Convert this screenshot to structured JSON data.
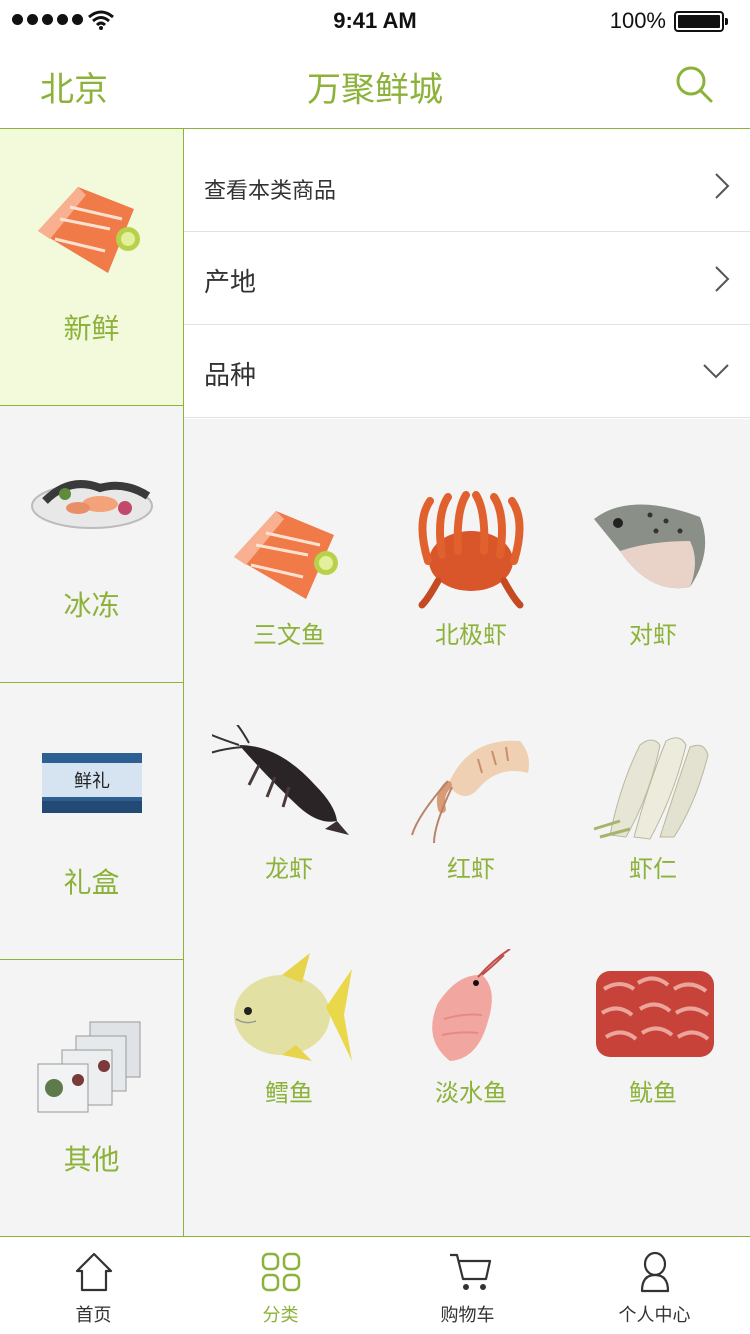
{
  "status_bar": {
    "time": "9:41 AM",
    "battery": "100%"
  },
  "nav": {
    "city": "北京",
    "title": "万聚鲜城"
  },
  "sidebar": {
    "items": [
      {
        "label": "新鲜",
        "active": true
      },
      {
        "label": "冰冻",
        "active": false
      },
      {
        "label": "礼盒",
        "active": false
      },
      {
        "label": "其他",
        "active": false
      }
    ]
  },
  "filters": [
    {
      "label": "查看本类商品",
      "icon": "chevron-right-icon"
    },
    {
      "label": "产地",
      "icon": "chevron-right-icon"
    },
    {
      "label": "品种",
      "icon": "chevron-down-icon"
    }
  ],
  "products": [
    {
      "name": "三文鱼"
    },
    {
      "name": "北极虾"
    },
    {
      "name": "对虾"
    },
    {
      "name": "龙虾"
    },
    {
      "name": "红虾"
    },
    {
      "name": "虾仁"
    },
    {
      "name": "鳕鱼"
    },
    {
      "name": "淡水鱼"
    },
    {
      "name": "鱿鱼"
    }
  ],
  "tabbar": {
    "items": [
      {
        "label": "首页",
        "icon": "home-icon",
        "active": false
      },
      {
        "label": "分类",
        "icon": "category-grid-icon",
        "active": true
      },
      {
        "label": "购物车",
        "icon": "cart-icon",
        "active": false
      },
      {
        "label": "个人中心",
        "icon": "user-icon",
        "active": false
      }
    ]
  },
  "colors": {
    "accent": "#8cb23a",
    "active_bg": "#f3fadc",
    "panel_bg": "#f4f4f4"
  }
}
